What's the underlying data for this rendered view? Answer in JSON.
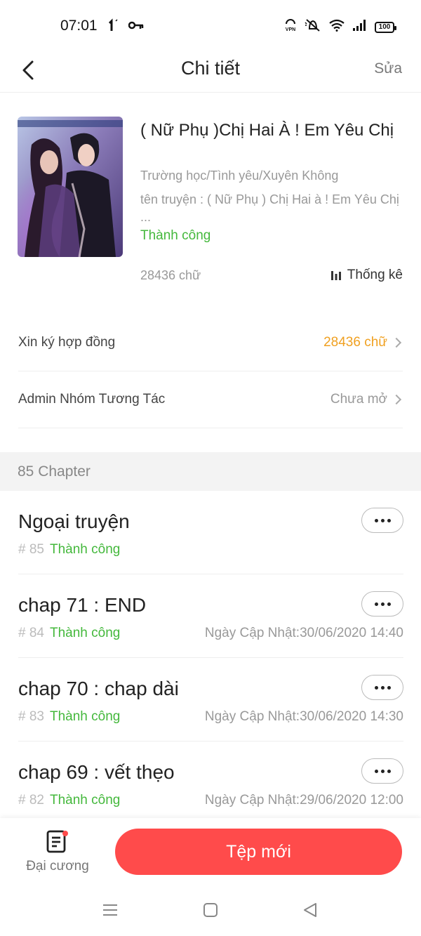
{
  "status_bar": {
    "time": "07:01",
    "battery": "100",
    "icons": [
      "arrow-icon",
      "key-icon",
      "vpn-icon",
      "mute-icon",
      "wifi-icon",
      "signal-icon",
      "battery-icon"
    ]
  },
  "header": {
    "title": "Chi tiết",
    "edit_label": "Sửa"
  },
  "book": {
    "title": "( Nữ Phụ )Chị Hai À ! Em Yêu Chị",
    "genre": "Trường học/Tình yêu/Xuyên Không",
    "description": "tên truyện : ( Nữ Phụ ) Chị Hai à ! Em Yêu Chị  ...",
    "status": "Thành công",
    "word_count": "28436 chữ",
    "stats_label": "Thống kê"
  },
  "settings": [
    {
      "label": "Xin ký hợp đồng",
      "value": "28436 chữ",
      "value_color": "#f0a020"
    },
    {
      "label": "Admin Nhóm Tương Tác",
      "value": "Chưa mở",
      "value_color": "#999999"
    }
  ],
  "chapters_header": "85 Chapter",
  "chapters": [
    {
      "title": "Ngoại truyện",
      "number": "# 85",
      "status": "Thành công",
      "date_label": "",
      "date": ""
    },
    {
      "title": "chap 71 : END",
      "number": "# 84",
      "status": "Thành công",
      "date_label": "Ngày Cập Nhật:",
      "date": "30/06/2020 14:40"
    },
    {
      "title": "chap 70 : chap dài",
      "number": "# 83",
      "status": "Thành công",
      "date_label": "Ngày Cập Nhật:",
      "date": "30/06/2020 14:30"
    },
    {
      "title": "chap 69 : vết thẹo",
      "number": "# 82",
      "status": "Thành công",
      "date_label": "Ngày Cập Nhật:",
      "date": "29/06/2020 12:00"
    }
  ],
  "bottom_bar": {
    "outline_label": "Đại cương",
    "new_file_label": "Tệp mới"
  },
  "colors": {
    "accent": "#ff4b4b",
    "success": "#44b83c",
    "highlight": "#f0a020"
  }
}
